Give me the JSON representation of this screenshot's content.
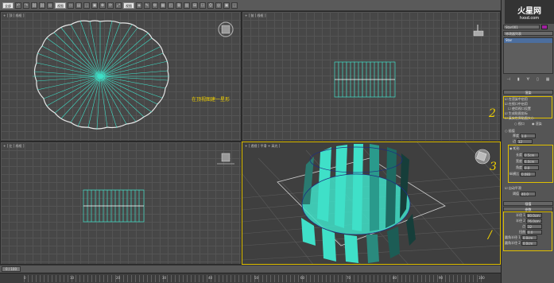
{
  "toolbar": {
    "selection_set": "全部",
    "view_dropdown": "视图",
    "items": [
      "↶",
      "↷",
      "⛓",
      "⛓",
      "◎",
      "▭",
      "⬚",
      "▣",
      "✥",
      "⟳",
      "⤢",
      "◈",
      "✎",
      "⚙",
      "▦",
      "◰",
      "⧉",
      "▤",
      "▥",
      "⛭",
      "☐",
      "⊞"
    ]
  },
  "viewports": {
    "top": {
      "label": "+ ] 顶 ] 线框 ]",
      "annotation": "在顶视图建一星形"
    },
    "front": {
      "label": "+ ] 前 ] 线框 ]"
    },
    "left": {
      "label": "+ ] 左 ] 线框 ]"
    },
    "persp": {
      "label": "+ ] 透视 ] 平滑 + 高光 ]"
    }
  },
  "command_panel": {
    "object_name": "Star001",
    "modifier_list": "修改器列表",
    "stack_item": "Star",
    "sections": {
      "render": {
        "title": "渲染",
        "options": [
          "在渲染中启用",
          "在视口中启用",
          "使用视口设置",
          "生成贴图坐标",
          "真实世界贴图大小"
        ],
        "radio": [
          "视口",
          "渲染"
        ]
      },
      "interp": {
        "title": "插值",
        "fields": [
          {
            "label": "厚度",
            "value": "1.0"
          },
          {
            "label": "边",
            "value": "12"
          }
        ]
      },
      "rect": {
        "title": "矩形",
        "fields": [
          {
            "label": "长度",
            "value": "0.5cm"
          },
          {
            "label": "宽度",
            "value": "6.0cm"
          },
          {
            "label": "角度",
            "value": "0.0"
          },
          {
            "label": "纵横比",
            "value": "0.083"
          }
        ]
      },
      "auto_smooth": {
        "label": "自动平滑",
        "threshold_label": "阈值",
        "threshold": "40.0"
      },
      "params": {
        "title": "参数",
        "fields": [
          {
            "label": "半径 1",
            "value": "80.0cm"
          },
          {
            "label": "半径 2",
            "value": "76.0cm"
          },
          {
            "label": "点",
            "value": "32"
          },
          {
            "label": "扭曲",
            "value": "0.0"
          },
          {
            "label": "圆角半径 1",
            "value": "0.0cm"
          },
          {
            "label": "圆角半径 2",
            "value": "0.0cm"
          }
        ]
      }
    },
    "annotations": [
      "2",
      "3",
      "/"
    ]
  },
  "timeline": {
    "slider_label": "0 / 100",
    "ticks": [
      "0",
      "10",
      "20",
      "30",
      "40",
      "50",
      "60",
      "70",
      "80",
      "90",
      "100"
    ]
  },
  "logo": {
    "title": "火星网",
    "url": "hxsd.com"
  },
  "colors": {
    "mesh": "#3fe0c8",
    "highlight": "#e0c000",
    "bg": "#474747"
  }
}
